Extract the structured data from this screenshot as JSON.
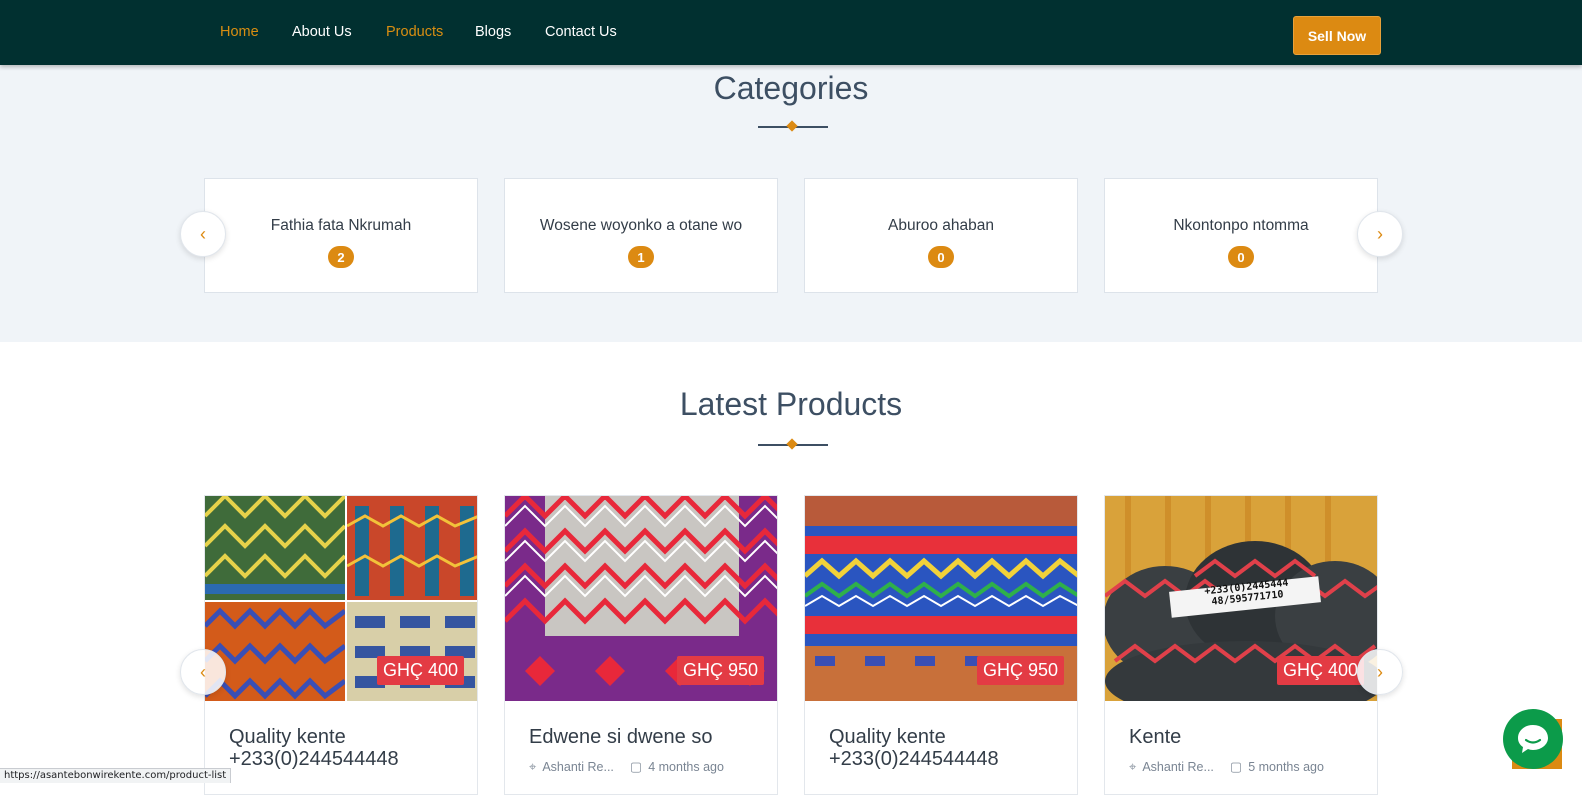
{
  "nav": {
    "links": [
      {
        "label": "Home",
        "active": true
      },
      {
        "label": "About Us",
        "active": false
      },
      {
        "label": "Products",
        "active": true
      },
      {
        "label": "Blogs",
        "active": false
      },
      {
        "label": "Contact Us",
        "active": false
      }
    ],
    "sell_button": "Sell Now"
  },
  "categories": {
    "title": "Categories",
    "items": [
      {
        "name": "Fathia fata Nkrumah",
        "count": "2"
      },
      {
        "name": "Wosene woyonko a otane wo",
        "count": "1"
      },
      {
        "name": "Aburoo ahaban",
        "count": "0"
      },
      {
        "name": "Nkontonpo ntomma",
        "count": "0"
      }
    ],
    "prev_icon": "‹",
    "next_icon": "›"
  },
  "latest": {
    "title": "Latest Products",
    "products": [
      {
        "title": "Quality kente +233(0)244544448",
        "price": "GHÇ 400",
        "location": "",
        "time": ""
      },
      {
        "title": "Edwene si dwene so",
        "price": "GHÇ 950",
        "location": "Ashanti Re...",
        "time": "4 months ago"
      },
      {
        "title": "Quality kente +233(0)244544448",
        "price": "GHÇ 950",
        "location": "",
        "time": ""
      },
      {
        "title": "Kente",
        "price": "GHÇ 400",
        "location": "Ashanti Re...",
        "time": "5 months ago"
      }
    ],
    "image_overlay_text": "+233(0)2445444 48/595771710",
    "prev_icon": "‹",
    "next_icon": "›"
  },
  "status_bar": {
    "url": "https://asantebonwirekente.com/product-list"
  },
  "colors": {
    "nav_bg": "#013030",
    "accent": "#dc8a12",
    "price_bg": "#e33b44",
    "section_bg": "#f0f4f8",
    "chat": "#0c9b4a"
  },
  "icons": {
    "location": "location-pin-icon",
    "time": "calendar-icon",
    "chat": "chat-icon"
  }
}
